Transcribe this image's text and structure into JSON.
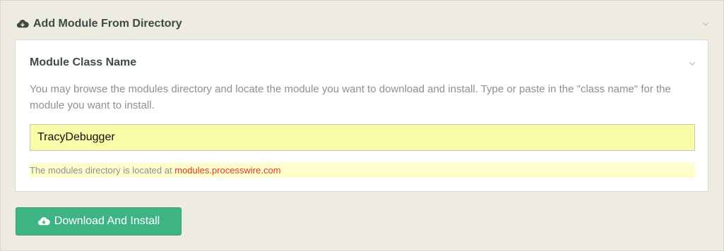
{
  "section": {
    "title": "Add Module From Directory",
    "icon": "cloud-download-icon"
  },
  "panel": {
    "title": "Module Class Name",
    "description": "You may browse the modules directory and locate the module you want to download and install. Type or paste in the \"class name\" for the module you want to install.",
    "input_value": "TracyDebugger",
    "note_prefix": "The modules directory is located at",
    "note_link": "modules.processwire.com"
  },
  "button": {
    "label": "Download And Install",
    "icon": "cloud-download-icon"
  },
  "colors": {
    "button_bg": "#3eb485",
    "input_bg": "#f8fca6",
    "link": "#e3342f",
    "page_bg": "#edeadf"
  }
}
